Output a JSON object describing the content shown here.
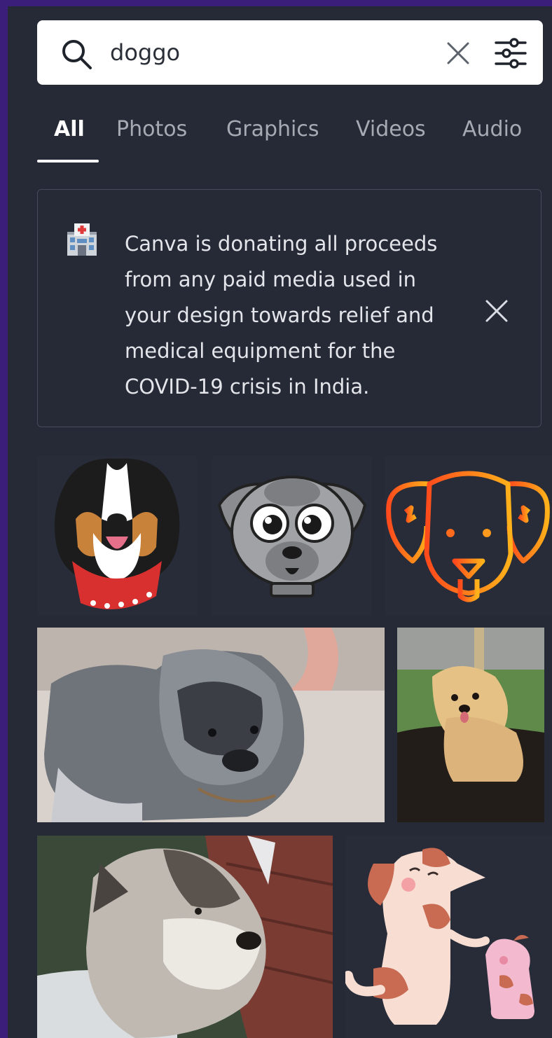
{
  "search": {
    "query": "doggo",
    "icons": {
      "search": "search-icon",
      "clear": "close-icon",
      "filter": "sliders-icon"
    }
  },
  "tabs": [
    {
      "label": "All",
      "active": true
    },
    {
      "label": "Photos",
      "active": false
    },
    {
      "label": "Graphics",
      "active": false
    },
    {
      "label": "Videos",
      "active": false
    },
    {
      "label": "Audio",
      "active": false
    }
  ],
  "notice": {
    "icon": "hospital-icon",
    "text": "Canva is donating all proceeds from any paid media used in your design towards relief and medical equipment for the COVID-19 crisis in India."
  },
  "colors": {
    "frame": "#3b1d7a",
    "panel": "#252a36",
    "accent_text": "#ffffff",
    "muted_text": "#a6aab3"
  }
}
